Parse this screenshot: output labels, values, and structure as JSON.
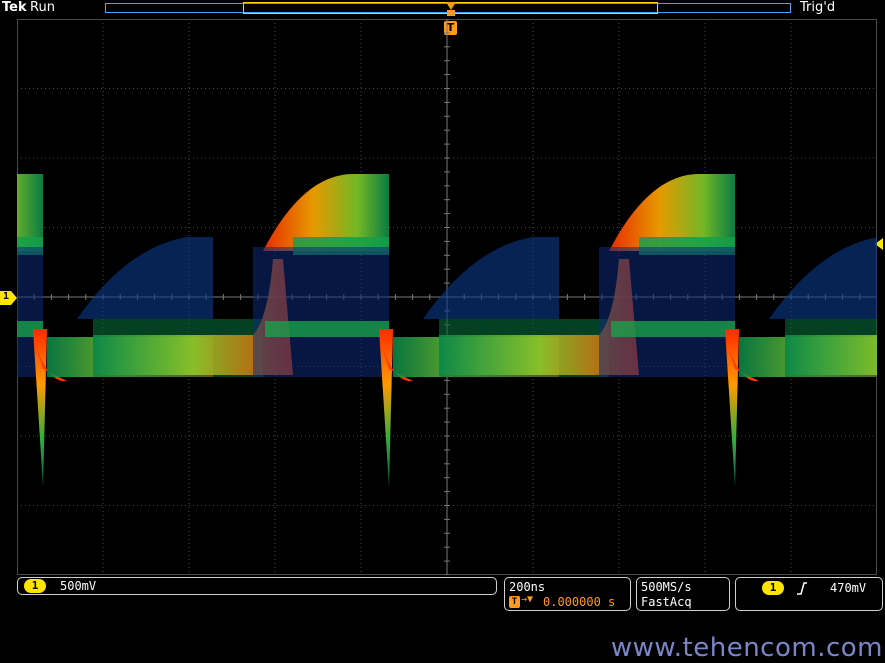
{
  "header": {
    "brand": "Tek",
    "state": "Run",
    "trigger_status": "Trig'd"
  },
  "markers": {
    "trigger_position": "T",
    "channel_ref": "1"
  },
  "status": {
    "channel": {
      "badge": "1",
      "scale": "500mV"
    },
    "timebase": {
      "per_div": "200ns",
      "position_icon": "T",
      "position": "0.000000 s"
    },
    "acquisition": {
      "sample_rate": "500MS/s",
      "mode": "FastAcq"
    },
    "trigger": {
      "badge": "1",
      "slope_icon": "rising-edge",
      "level": "470mV"
    }
  },
  "colors": {
    "grid": "#4a4a4a",
    "channel": "#ffe400",
    "timebase_orange": "#ff9a20",
    "record_bar": "#4aa0ff",
    "watermark": "#7b86c8"
  },
  "watermark": "www.tehencom.com"
}
